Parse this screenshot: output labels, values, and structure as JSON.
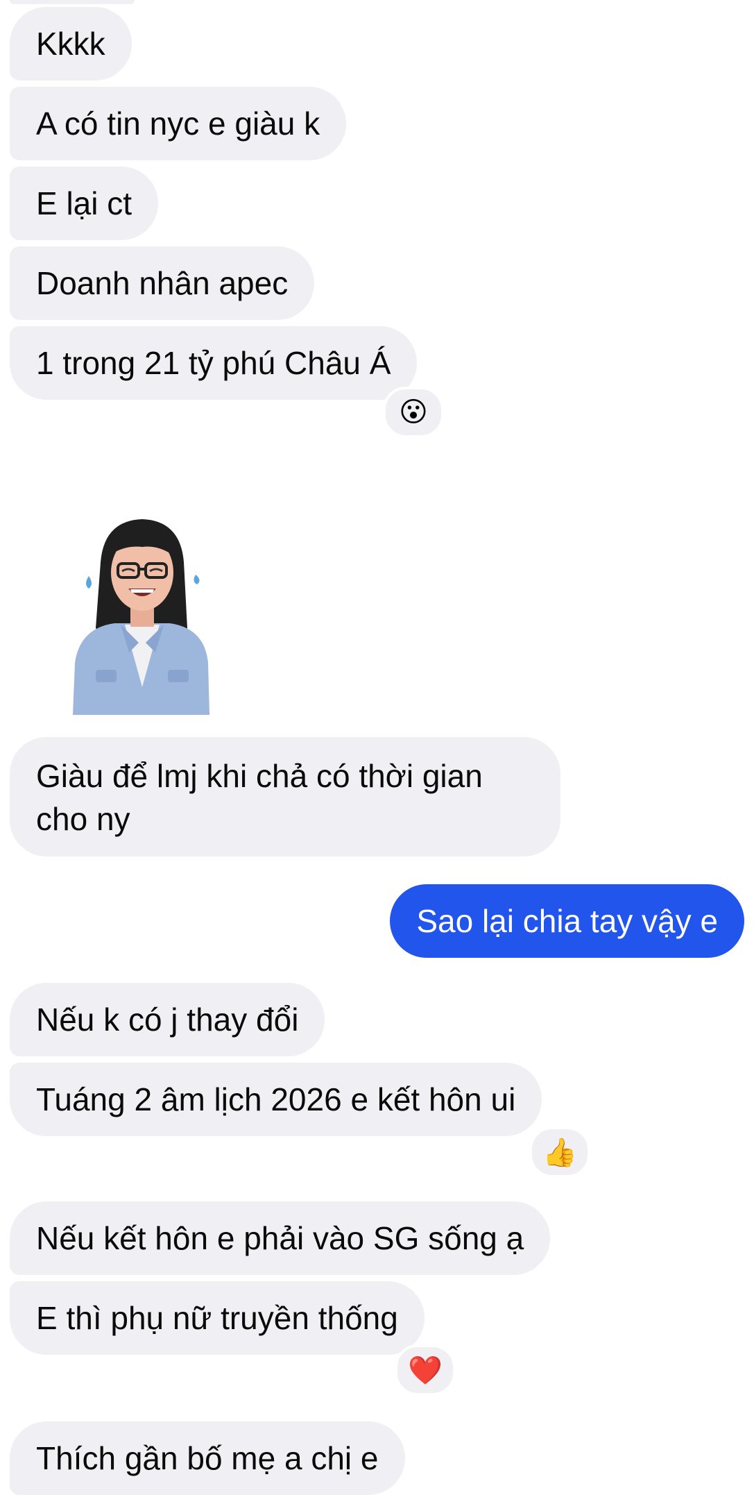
{
  "messages": [
    {
      "text": "Kkkk"
    },
    {
      "text": "A có tin nyc e giàu k"
    },
    {
      "text": "E lại ct"
    },
    {
      "text": "Doanh nhân apec"
    },
    {
      "text": "1 trong 21 tỷ phú Châu Á",
      "reaction": "😮"
    },
    {
      "sticker": "memoji-laughing-tears-sticker"
    },
    {
      "text": "Giàu để lmj khi chả có thời gian cho ny"
    },
    {
      "text": "Sao lại chia tay vậy e",
      "outgoing": true
    },
    {
      "text": "Nếu k có j thay đổi"
    },
    {
      "text": "Tuáng 2 âm lịch 2026 e kết hôn ui",
      "reaction": "👍"
    },
    {
      "text": "Nếu kết hôn e phải vào SG sống ạ"
    },
    {
      "text": "E thì phụ nữ truyền thống",
      "reaction": "❤️"
    },
    {
      "text": "Thích gần bố mẹ a chị e"
    }
  ],
  "colors": {
    "incoming_bubble": "#efeff4",
    "outgoing_bubble": "#2155ec",
    "background": "#ffffff"
  }
}
